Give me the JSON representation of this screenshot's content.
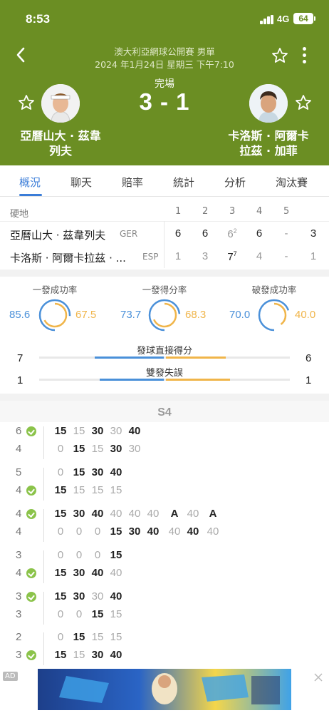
{
  "status_bar": {
    "time": "8:53",
    "network": "4G",
    "battery": "64"
  },
  "match": {
    "tournament": "澳大利亞網球公開賽 男單",
    "datetime": "2024 年1月24日 星期三 下午7:10",
    "state": "完場",
    "score": "3 - 1",
    "player1": {
      "name_line1": "亞曆山大 · 茲韋",
      "name_line2": "列夫"
    },
    "player2": {
      "name_line1": "卡洛斯 · 阿爾卡",
      "name_line2": "拉茲 · 加菲"
    }
  },
  "tabs": [
    "概況",
    "聊天",
    "賠率",
    "統計",
    "分析",
    "淘汰賽"
  ],
  "scoreboard": {
    "surface": "硬地",
    "set_headers": [
      "1",
      "2",
      "3",
      "4",
      "5"
    ],
    "rows": [
      {
        "name": "亞曆山大 · 茲韋列夫",
        "country": "GER",
        "sets": [
          "6",
          "6",
          "6",
          "6",
          "-"
        ],
        "tiebreak": [
          "",
          "",
          "2",
          "",
          ""
        ],
        "total": "3"
      },
      {
        "name": "卡洛斯 · 阿爾卡拉茲 · ...",
        "country": "ESP",
        "sets": [
          "1",
          "3",
          "7",
          "4",
          "-"
        ],
        "tiebreak": [
          "",
          "",
          "7",
          "",
          ""
        ],
        "total": "1"
      }
    ]
  },
  "stats": {
    "rings": [
      {
        "title": "一發成功率",
        "left": "85.6",
        "right": "67.5"
      },
      {
        "title": "一發得分率",
        "left": "73.7",
        "right": "68.3"
      },
      {
        "title": "破發成功率",
        "left": "70.0",
        "right": "40.0"
      }
    ],
    "bars": [
      {
        "label": "發球直接得分",
        "left": "7",
        "right": "6"
      },
      {
        "label": "雙發失誤",
        "left": "1",
        "right": "1"
      }
    ]
  },
  "set_label": "S4",
  "games": [
    {
      "rows": [
        {
          "score": "6",
          "serve": true,
          "points": [
            [
              "15",
              "b"
            ],
            [
              "15",
              "g"
            ],
            [
              "30",
              "b"
            ],
            [
              "30",
              "g"
            ],
            [
              "40",
              "b"
            ]
          ]
        },
        {
          "score": "4",
          "serve": false,
          "points": [
            [
              "0",
              "g"
            ],
            [
              "15",
              "b"
            ],
            [
              "15",
              "g"
            ],
            [
              "30",
              "b"
            ],
            [
              "30",
              "g"
            ]
          ]
        }
      ]
    },
    {
      "rows": [
        {
          "score": "5",
          "serve": false,
          "points": [
            [
              "0",
              "g"
            ],
            [
              "15",
              "b"
            ],
            [
              "30",
              "b"
            ],
            [
              "40",
              "b"
            ]
          ]
        },
        {
          "score": "4",
          "serve": true,
          "points": [
            [
              "15",
              "b"
            ],
            [
              "15",
              "g"
            ],
            [
              "15",
              "g"
            ],
            [
              "15",
              "g"
            ]
          ]
        }
      ]
    },
    {
      "rows": [
        {
          "score": "4",
          "serve": true,
          "points": [
            [
              "15",
              "b"
            ],
            [
              "30",
              "b"
            ],
            [
              "40",
              "b"
            ],
            [
              "40",
              "g"
            ],
            [
              "40",
              "g"
            ],
            [
              "40",
              "g"
            ],
            [
              "A",
              "b"
            ],
            [
              "40",
              "g"
            ],
            [
              "A",
              "b"
            ]
          ]
        },
        {
          "score": "4",
          "serve": false,
          "points": [
            [
              "0",
              "g"
            ],
            [
              "0",
              "g"
            ],
            [
              "0",
              "g"
            ],
            [
              "15",
              "b"
            ],
            [
              "30",
              "b"
            ],
            [
              "40",
              "b"
            ],
            [
              "40",
              "g"
            ],
            [
              "40",
              "b"
            ],
            [
              "40",
              "g"
            ]
          ]
        }
      ]
    },
    {
      "rows": [
        {
          "score": "3",
          "serve": false,
          "points": [
            [
              "0",
              "g"
            ],
            [
              "0",
              "g"
            ],
            [
              "0",
              "g"
            ],
            [
              "15",
              "b"
            ]
          ]
        },
        {
          "score": "4",
          "serve": true,
          "points": [
            [
              "15",
              "b"
            ],
            [
              "30",
              "b"
            ],
            [
              "40",
              "b"
            ],
            [
              "40",
              "g"
            ]
          ]
        }
      ]
    },
    {
      "rows": [
        {
          "score": "3",
          "serve": true,
          "points": [
            [
              "15",
              "b"
            ],
            [
              "30",
              "b"
            ],
            [
              "30",
              "g"
            ],
            [
              "40",
              "b"
            ]
          ]
        },
        {
          "score": "3",
          "serve": false,
          "points": [
            [
              "0",
              "g"
            ],
            [
              "0",
              "g"
            ],
            [
              "15",
              "b"
            ],
            [
              "15",
              "g"
            ]
          ]
        }
      ]
    },
    {
      "rows": [
        {
          "score": "2",
          "serve": false,
          "points": [
            [
              "0",
              "g"
            ],
            [
              "15",
              "b"
            ],
            [
              "15",
              "g"
            ],
            [
              "15",
              "g"
            ]
          ]
        },
        {
          "score": "3",
          "serve": true,
          "points": [
            [
              "15",
              "b"
            ],
            [
              "15",
              "g"
            ],
            [
              "30",
              "b"
            ],
            [
              "40",
              "b"
            ]
          ]
        }
      ]
    }
  ],
  "ad": {
    "tag": "AD"
  },
  "colors": {
    "header_bg": "#6b8e23",
    "accent_blue": "#3b7dd8",
    "home": "#4a90d9",
    "away": "#f0b54a"
  },
  "icons": [
    "back-icon",
    "star-icon",
    "more-icon",
    "serve-ball-icon",
    "close-icon"
  ]
}
